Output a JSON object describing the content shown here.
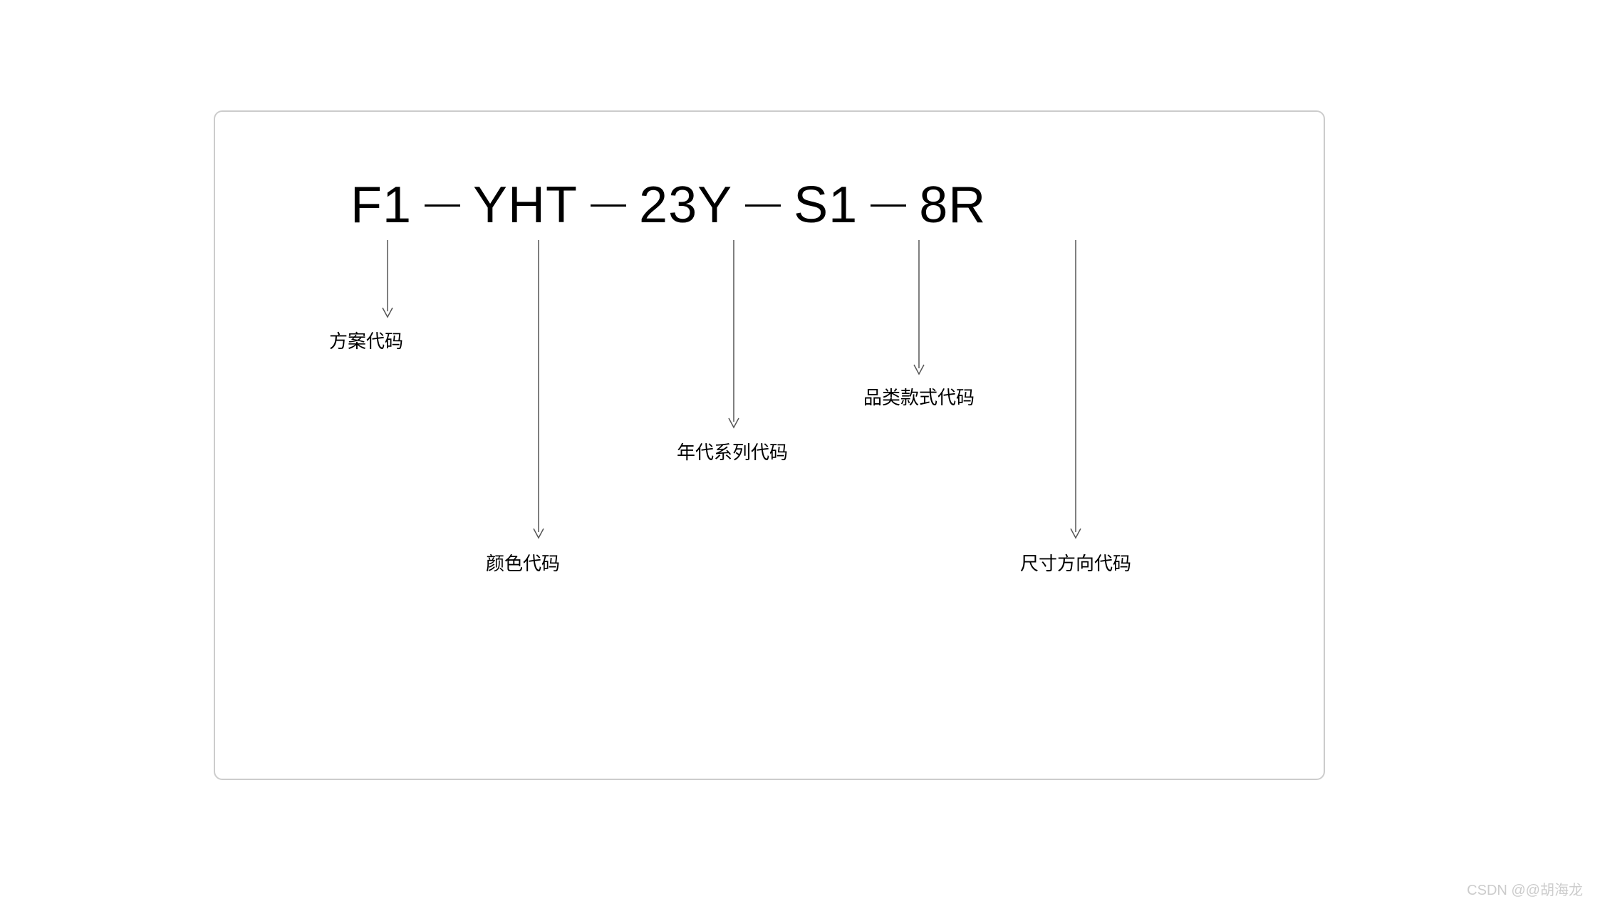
{
  "code": {
    "segments": [
      "F1",
      "YHT",
      "23Y",
      "S1",
      "8R"
    ],
    "separator": "—"
  },
  "labels": {
    "seg1": "方案代码",
    "seg2": "颜色代码",
    "seg3": "年代系列代码",
    "seg4": "品类款式代码",
    "seg5": "尺寸方向代码"
  },
  "watermark": "CSDN @@胡海龙"
}
